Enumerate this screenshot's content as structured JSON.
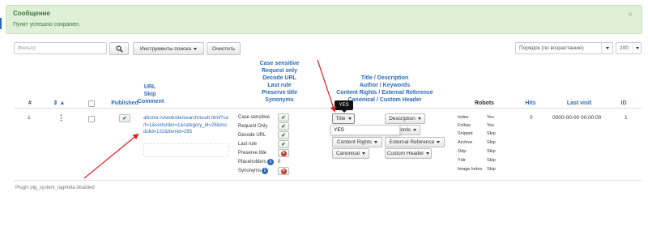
{
  "message": {
    "title": "Сообщение",
    "text": "Пункт успешно сохранен.",
    "close": "×"
  },
  "toolbar": {
    "filter_placeholder": "Фильтр",
    "search_icon": "search-icon",
    "search_tools_label": "Инструменты поиска",
    "clear_label": "Очистить",
    "order_value": "Порядок (по возрастанию)",
    "limit_value": "200"
  },
  "columns": {
    "hash": "#",
    "checkbox": "",
    "published": "Published",
    "url": "URL",
    "skip": "Skip",
    "comment": "Comment",
    "case_sensitive": "Case sensitive",
    "request_only": "Request only",
    "decode_url": "Decode URL",
    "last_rule": "Last rule",
    "preserve_title": "Preserve title",
    "synonyms": "Synonyms",
    "title_description": "Title / Description",
    "author_keywords": "Author / Keywords",
    "content_rights_external": "Content Rights / External Reference",
    "canonical_custom_header": "Canonical / Custom Header",
    "robots": "Robots",
    "hits": "Hits",
    "last_visit": "Last visit",
    "id": "ID"
  },
  "row": {
    "number": "1",
    "url": "allcolor.ru/wobsite/searchresult.html?cart=1&sortorder=1&category_id=28&modulid=132&Itemid=285",
    "options": [
      {
        "label": "Case sensitive",
        "state": "on"
      },
      {
        "label": "Request Only",
        "state": "on"
      },
      {
        "label": "Decode URL",
        "state": "on"
      },
      {
        "label": "Last rule",
        "state": "on"
      },
      {
        "label": "Preserve title",
        "state": "off"
      },
      {
        "label": "Placeholders",
        "count": "0"
      },
      {
        "label": "Synonyms",
        "state": "off"
      }
    ],
    "buttons": {
      "title": "Title",
      "description": "Description",
      "keywords": "Keywords",
      "content_rights": "Content Rights",
      "external_reference": "External Reference",
      "canonical": "Canonical",
      "custom_header": "Custom Header"
    },
    "tooltip": "YES",
    "title_input_value": "YES",
    "robots": [
      {
        "label": "Index",
        "value": "Yes"
      },
      {
        "label": "Follow",
        "value": "Yes"
      },
      {
        "label": "Snippet",
        "value": "Skip"
      },
      {
        "label": "Archive",
        "value": "Skip"
      },
      {
        "label": "Odp",
        "value": "Skip"
      },
      {
        "label": "Ydir",
        "value": "Skip"
      },
      {
        "label": "Image Index",
        "value": "Skip"
      }
    ],
    "hits": "0",
    "last_visit": "0000-00-00 00:00:00",
    "id": "1"
  },
  "footer": {
    "plugin_note": "Plugin plg_system_tagmeta disabled"
  },
  "colors": {
    "link": "#2a69b8",
    "success_bg": "#dff0d8",
    "success_text": "#3c763d",
    "annotation_arrow": "#e02020"
  }
}
